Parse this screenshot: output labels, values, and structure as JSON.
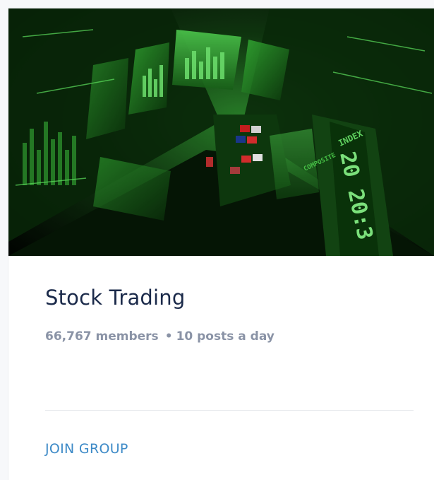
{
  "group": {
    "cover_alt": "",
    "title": "Stock Trading",
    "members_text": "66,767 members",
    "separator": "•",
    "posts_text": "10 posts a day",
    "action_label": "JOIN GROUP"
  },
  "cover_overlay_text": {
    "index_label": "INDEX",
    "ticker_digits": "20 20:3",
    "composite_label": "COMPOSITE"
  },
  "colors": {
    "title": "#1b2a4a",
    "meta": "#8a93a6",
    "link": "#3d8ac7",
    "cover_green": "#3fdc3f"
  }
}
